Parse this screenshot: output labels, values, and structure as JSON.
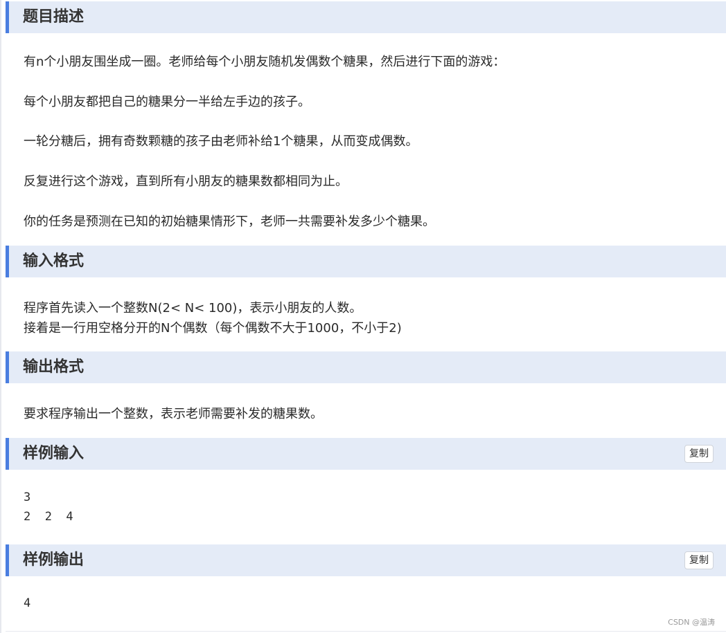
{
  "sections": {
    "description": {
      "title": "题目描述",
      "paragraphs": [
        "有n个小朋友围坐成一圈。老师给每个小朋友随机发偶数个糖果，然后进行下面的游戏：",
        "每个小朋友都把自己的糖果分一半给左手边的孩子。",
        "一轮分糖后，拥有奇数颗糖的孩子由老师补给1个糖果，从而变成偶数。",
        "反复进行这个游戏，直到所有小朋友的糖果数都相同为止。",
        "你的任务是预测在已知的初始糖果情形下，老师一共需要补发多少个糖果。"
      ]
    },
    "input_format": {
      "title": "输入格式",
      "lines": [
        "程序首先读入一个整数N(2< N< 100)，表示小朋友的人数。",
        "接着是一行用空格分开的N个偶数（每个偶数不大于1000，不小于2)"
      ]
    },
    "output_format": {
      "title": "输出格式",
      "lines": [
        "要求程序输出一个整数，表示老师需要补发的糖果数。"
      ]
    },
    "sample_input": {
      "title": "样例输入",
      "copy_label": "复制",
      "lines": [
        "3",
        "2  2  4"
      ]
    },
    "sample_output": {
      "title": "样例输出",
      "copy_label": "复制",
      "lines": [
        "4"
      ]
    }
  },
  "watermark": "CSDN @温涛",
  "colors": {
    "header_bg": "#e4ebf7",
    "accent": "#4a7ee0"
  }
}
